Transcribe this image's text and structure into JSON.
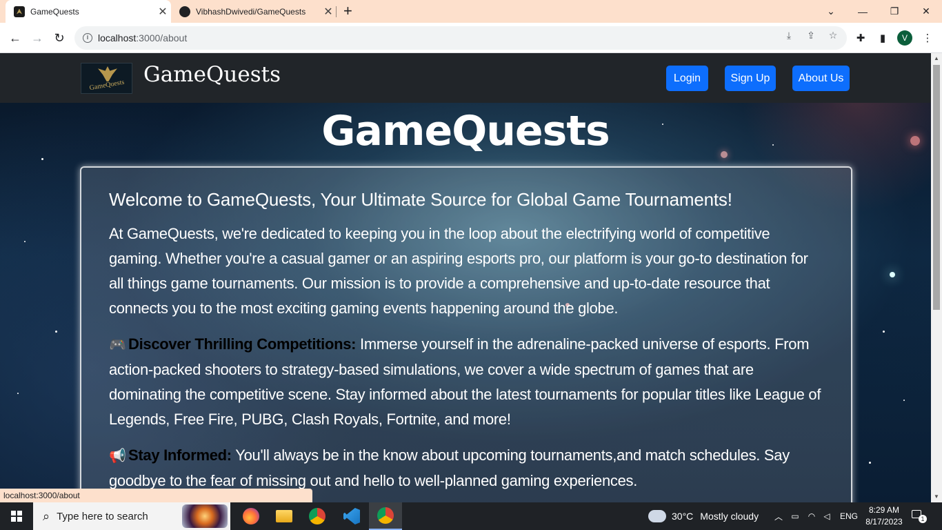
{
  "browser": {
    "tabs": [
      {
        "title": "GameQuests",
        "active": true,
        "icon": "gamequests-favicon"
      },
      {
        "title": "VibhashDwivedi/GameQuests",
        "active": false,
        "icon": "github-icon"
      }
    ],
    "close_symbol": "✕",
    "new_tab_symbol": "+",
    "url_host": "localhost",
    "url_path": ":3000/about",
    "profile_initial": "V",
    "status_url": "localhost:3000/about"
  },
  "site": {
    "brand": "GameQuests",
    "logo_text": "GameQuests",
    "nav": {
      "login": "Login",
      "signup": "Sign Up",
      "about": "About Us"
    },
    "hero_title": "GameQuests",
    "about": {
      "heading": "Welcome to GameQuests, Your Ultimate Source for Global Game Tournaments!",
      "intro": "At GameQuests, we're dedicated to keeping you in the loop about the electrifying world of competitive gaming. Whether you're a casual gamer or an aspiring esports pro, our platform is your go-to destination for all things game tournaments. Our mission is to provide a comprehensive and up-to-date resource that connects you to the most exciting gaming events happening around the globe.",
      "sections": [
        {
          "emoji": "🎮",
          "lead": "Discover Thrilling Competitions:",
          "text": " Immerse yourself in the adrenaline-packed universe of esports. From action-packed shooters to strategy-based simulations, we cover a wide spectrum of games that are dominating the competitive scene. Stay informed about the latest tournaments for popular titles like League of Legends, Free Fire, PUBG, Clash Royals, Fortnite, and more!"
        },
        {
          "emoji": "📢",
          "lead": "Stay Informed:",
          "text": " You'll always be in the know about upcoming tournaments,and match schedules. Say goodbye to the fear of missing out and hello to well-planned gaming experiences."
        }
      ]
    }
  },
  "taskbar": {
    "search_placeholder": "Type here to search",
    "weather_temp": "30°C",
    "weather_desc": "Mostly cloudy",
    "language": "ENG",
    "time": "8:29 AM",
    "date": "8/17/2023",
    "notification_count": "1"
  },
  "colors": {
    "tabbar": "#fde0cc",
    "site_nav": "#212529",
    "primary_button": "#0d6efd",
    "lead_text": "#000000"
  }
}
